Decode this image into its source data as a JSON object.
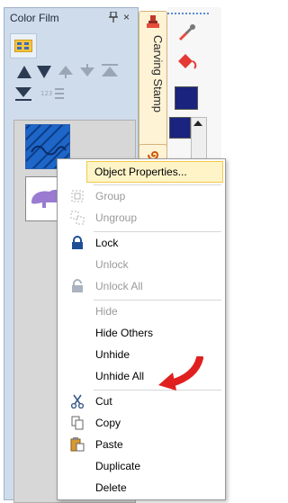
{
  "panel": {
    "title": "Color Film",
    "pin_icon": "pin-icon",
    "close_label": "×"
  },
  "carving_stamp": {
    "tab_label": "Carving Stamp"
  },
  "colors": {
    "swatch_navy": "#1a237e",
    "thumb_blue": "#1e66c8",
    "bear_purple": "#9a7bd1",
    "menu_highlight": "#fff4c8",
    "arrow_red": "#e02020"
  },
  "context_menu": {
    "object_properties": "Object Properties...",
    "group": "Group",
    "ungroup": "Ungroup",
    "lock": "Lock",
    "unlock": "Unlock",
    "unlock_all": "Unlock All",
    "hide": "Hide",
    "hide_others": "Hide Others",
    "unhide": "Unhide",
    "unhide_all": "Unhide All",
    "cut": "Cut",
    "copy": "Copy",
    "paste": "Paste",
    "duplicate": "Duplicate",
    "delete": "Delete"
  }
}
